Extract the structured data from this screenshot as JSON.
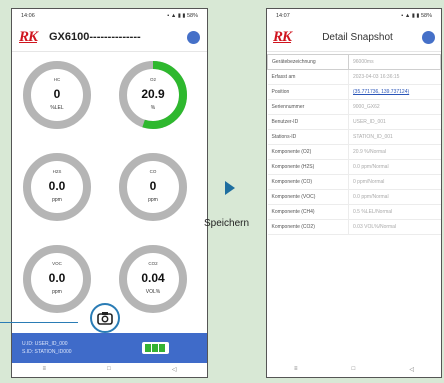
{
  "left_phone": {
    "status_time": "14:06",
    "status_icons": "▪ ▲ ▮ ▮ 58%",
    "app_logo": "RK",
    "device_name": "GX6100--------------",
    "gauges": [
      {
        "name": "HC",
        "value": "0",
        "unit": "%LEL",
        "fill": 0,
        "color": "#b0b0b0"
      },
      {
        "name": "O2",
        "value": "20.9",
        "unit": "%",
        "fill": 0.55,
        "color": "#2eb82e"
      },
      {
        "name": "H2S",
        "value": "0.0",
        "unit": "ppm",
        "fill": 0,
        "color": "#b0b0b0"
      },
      {
        "name": "CO",
        "value": "0",
        "unit": "ppm",
        "fill": 0,
        "color": "#b0b0b0"
      },
      {
        "name": "VOC",
        "value": "0.0",
        "unit": "ppm",
        "fill": 0,
        "color": "#b0b0b0"
      },
      {
        "name": "CO2",
        "value": "0.04",
        "unit": "VOL%",
        "fill": 0,
        "color": "#b0b0b0"
      }
    ],
    "user_id": "U.ID: USER_ID_000",
    "station_id": "S.ID: STATION_ID000",
    "nav_buttons": [
      "≡",
      "□",
      "◁"
    ]
  },
  "arrow_label": "Speichern",
  "right_phone": {
    "status_time": "14:07",
    "status_icons": "▪ ▲ ▮ ▮ 58%",
    "app_logo": "RK",
    "title": "Detail Snapshot",
    "rows": [
      {
        "key": "Gerätebezeichnung",
        "value": "96000ms"
      },
      {
        "key": "Erfasst am",
        "value": "2023-04-03 16:36:15"
      },
      {
        "key": "Position",
        "value": "(35.771736, 139.737124)"
      },
      {
        "key": "Seriennummer",
        "value": "9000_GX62"
      },
      {
        "key": "Benutzer-ID",
        "value": "USER_ID_001"
      },
      {
        "key": "Stations-ID",
        "value": "STATION_ID_001"
      },
      {
        "key": "Komponente (O2)",
        "value": "20.9 %/Normal"
      },
      {
        "key": "Komponente (H2S)",
        "value": "0.0 ppm/Normal"
      },
      {
        "key": "Komponente (CO)",
        "value": "0 ppm/Normal"
      },
      {
        "key": "Komponente (VOC)",
        "value": "0.0 ppm/Normal"
      },
      {
        "key": "Komponente (CH4)",
        "value": "0.5 %LEL/Normal"
      },
      {
        "key": "Komponente (CO2)",
        "value": "0.03 VOL%/Normal"
      }
    ],
    "nav_buttons": [
      "≡",
      "□",
      "◁"
    ]
  }
}
